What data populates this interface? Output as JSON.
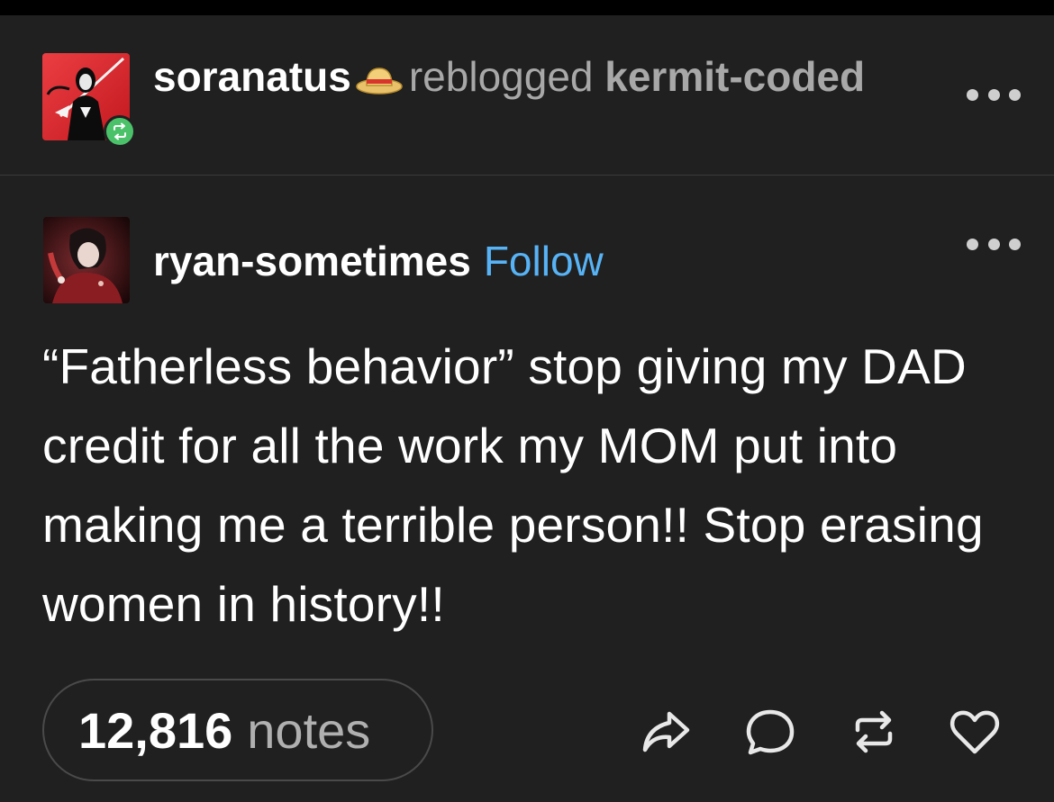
{
  "reblog": {
    "reblogger": "soranatus",
    "action_text": "reblogged",
    "source": "kermit-coded",
    "hat_icon": "straw-hat-icon"
  },
  "post": {
    "author": "ryan-sometimes",
    "follow_label": "Follow",
    "body": "“Fatherless behavior” stop giving my DAD credit for all the work my MOM put into making me a terrible person!! Stop erasing women in history!!"
  },
  "footer": {
    "notes_count": "12,816",
    "notes_label": "notes",
    "actions": [
      "share-icon",
      "reply-icon",
      "reblog-icon",
      "like-icon"
    ]
  },
  "colors": {
    "background": "#202020",
    "follow": "#57b3f5",
    "reblog_badge": "#4bc26a"
  }
}
